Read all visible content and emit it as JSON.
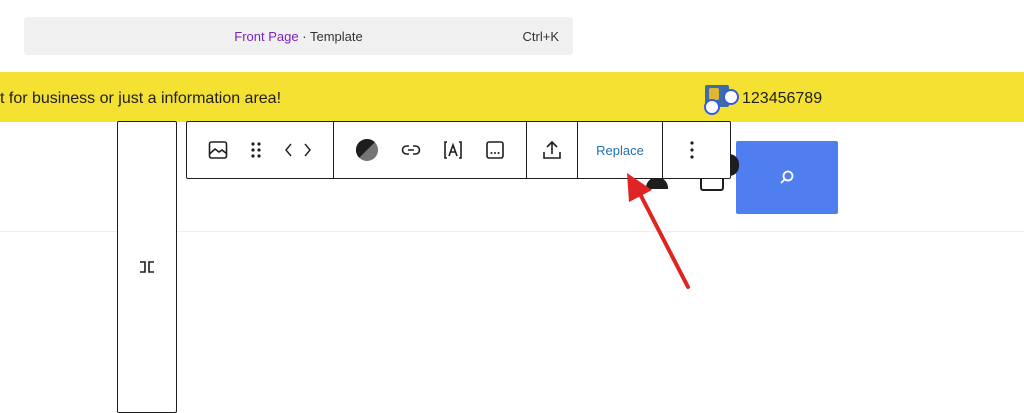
{
  "command_bar": {
    "page_name": "Front Page",
    "separator": "·",
    "page_type": "Template",
    "shortcut": "Ctrl+K"
  },
  "header_bar": {
    "message": "t for business or just a information area!",
    "phone": "123456789",
    "background": "#f5e131"
  },
  "toolbar": {
    "replace_label": "Replace",
    "icons": [
      "transform-icon",
      "image-icon",
      "drag-handle-icon",
      "move-arrows-icon",
      "duotone-icon",
      "link-icon",
      "text-overlay-icon",
      "caption-icon",
      "upload-icon",
      "more-options-icon"
    ]
  },
  "colors": {
    "accent": "#3858e9",
    "replace_text": "#2271b1",
    "search_button": "#4f7ef0",
    "page_link": "#7b22c4",
    "annotation_arrow": "#e02424"
  }
}
